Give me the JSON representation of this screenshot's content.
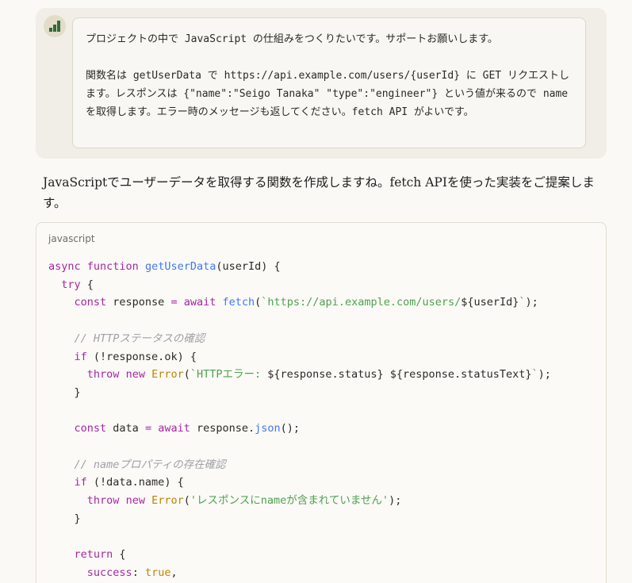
{
  "user_message": {
    "avatar_icon": "bars-logo-icon",
    "paragraphs": [
      "プロジェクトの中で JavaScript の仕組みをつくりたいです。サポートお願いします。",
      "関数名は getUserData で https://api.example.com/users/{userId} に GET リクエストします。レスポンスは {\"name\":\"Seigo Tanaka\" \"type\":\"engineer\"} という値が来るので name を取得します。エラー時のメッセージも返してください。fetch API がよいです。"
    ]
  },
  "assistant": {
    "intro_text": "JavaScriptでユーザーデータを取得する関数を作成しますね。fetch APIを使った実装をご提案します。",
    "code_block": {
      "language": "javascript",
      "lines": [
        [
          {
            "t": "kw",
            "v": "async"
          },
          {
            "t": "pl",
            "v": " "
          },
          {
            "t": "kw",
            "v": "function"
          },
          {
            "t": "pl",
            "v": " "
          },
          {
            "t": "fn",
            "v": "getUserData"
          },
          {
            "t": "pl",
            "v": "(userId) {"
          }
        ],
        [
          {
            "t": "pl",
            "v": "  "
          },
          {
            "t": "kw",
            "v": "try"
          },
          {
            "t": "pl",
            "v": " {"
          }
        ],
        [
          {
            "t": "pl",
            "v": "    "
          },
          {
            "t": "kw",
            "v": "const"
          },
          {
            "t": "pl",
            "v": " response "
          },
          {
            "t": "kw",
            "v": "="
          },
          {
            "t": "pl",
            "v": " "
          },
          {
            "t": "kw",
            "v": "await"
          },
          {
            "t": "pl",
            "v": " "
          },
          {
            "t": "fn",
            "v": "fetch"
          },
          {
            "t": "pl",
            "v": "("
          },
          {
            "t": "str",
            "v": "`https://api.example.com/users/"
          },
          {
            "t": "pl",
            "v": "${userId}"
          },
          {
            "t": "str",
            "v": "`"
          },
          {
            "t": "pl",
            "v": ");"
          }
        ],
        [],
        [
          {
            "t": "pl",
            "v": "    "
          },
          {
            "t": "com",
            "v": "// HTTPステータスの確認"
          }
        ],
        [
          {
            "t": "pl",
            "v": "    "
          },
          {
            "t": "kw",
            "v": "if"
          },
          {
            "t": "pl",
            "v": " (!response.ok) {"
          }
        ],
        [
          {
            "t": "pl",
            "v": "      "
          },
          {
            "t": "kw",
            "v": "throw"
          },
          {
            "t": "pl",
            "v": " "
          },
          {
            "t": "kw",
            "v": "new"
          },
          {
            "t": "pl",
            "v": " "
          },
          {
            "t": "cls",
            "v": "Error"
          },
          {
            "t": "pl",
            "v": "("
          },
          {
            "t": "str",
            "v": "`HTTPエラー: "
          },
          {
            "t": "pl",
            "v": "${response.status} ${response.statusText}"
          },
          {
            "t": "str",
            "v": "`"
          },
          {
            "t": "pl",
            "v": ");"
          }
        ],
        [
          {
            "t": "pl",
            "v": "    }"
          }
        ],
        [],
        [
          {
            "t": "pl",
            "v": "    "
          },
          {
            "t": "kw",
            "v": "const"
          },
          {
            "t": "pl",
            "v": " data "
          },
          {
            "t": "kw",
            "v": "="
          },
          {
            "t": "pl",
            "v": " "
          },
          {
            "t": "kw",
            "v": "await"
          },
          {
            "t": "pl",
            "v": " response."
          },
          {
            "t": "fn",
            "v": "json"
          },
          {
            "t": "pl",
            "v": "();"
          }
        ],
        [],
        [
          {
            "t": "pl",
            "v": "    "
          },
          {
            "t": "com",
            "v": "// nameプロパティの存在確認"
          }
        ],
        [
          {
            "t": "pl",
            "v": "    "
          },
          {
            "t": "kw",
            "v": "if"
          },
          {
            "t": "pl",
            "v": " (!data.name) {"
          }
        ],
        [
          {
            "t": "pl",
            "v": "      "
          },
          {
            "t": "kw",
            "v": "throw"
          },
          {
            "t": "pl",
            "v": " "
          },
          {
            "t": "kw",
            "v": "new"
          },
          {
            "t": "pl",
            "v": " "
          },
          {
            "t": "cls",
            "v": "Error"
          },
          {
            "t": "pl",
            "v": "("
          },
          {
            "t": "str",
            "v": "'レスポンスにnameが含まれていません'"
          },
          {
            "t": "pl",
            "v": ");"
          }
        ],
        [
          {
            "t": "pl",
            "v": "    }"
          }
        ],
        [],
        [
          {
            "t": "pl",
            "v": "    "
          },
          {
            "t": "kw",
            "v": "return"
          },
          {
            "t": "pl",
            "v": " {"
          }
        ],
        [
          {
            "t": "pl",
            "v": "      "
          },
          {
            "t": "kw",
            "v": "success"
          },
          {
            "t": "pl",
            "v": ": "
          },
          {
            "t": "cls",
            "v": "true"
          },
          {
            "t": "pl",
            "v": ","
          }
        ]
      ]
    }
  },
  "colors": {
    "page_background": "#faf9f5",
    "user_bubble": "#f0eee6",
    "keyword": "#a626a4",
    "function": "#4078f2",
    "string": "#50a14f",
    "class": "#c18401",
    "comment": "#a0a1a7"
  }
}
